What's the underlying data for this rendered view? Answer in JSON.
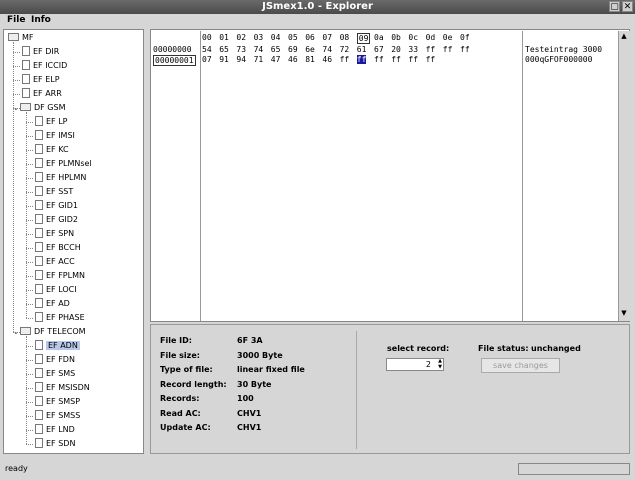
{
  "window": {
    "title": "JSmex1.0 - Explorer",
    "controls": [
      "▢",
      "✕"
    ]
  },
  "menu": [
    {
      "label": "File"
    },
    {
      "label": "Info"
    }
  ],
  "tree": [
    {
      "label": "MF",
      "kind": "folder",
      "level": 0,
      "open": true
    },
    {
      "label": "EF DIR",
      "kind": "file",
      "level": 1
    },
    {
      "label": "EF ICCID",
      "kind": "file",
      "level": 1
    },
    {
      "label": "EF ELP",
      "kind": "file",
      "level": 1
    },
    {
      "label": "EF ARR",
      "kind": "file",
      "level": 1
    },
    {
      "label": "DF GSM",
      "kind": "folder",
      "level": 1,
      "open": true
    },
    {
      "label": "EF LP",
      "kind": "file",
      "level": 2
    },
    {
      "label": "EF IMSI",
      "kind": "file",
      "level": 2
    },
    {
      "label": "EF KC",
      "kind": "file",
      "level": 2
    },
    {
      "label": "EF PLMNsel",
      "kind": "file",
      "level": 2
    },
    {
      "label": "EF HPLMN",
      "kind": "file",
      "level": 2
    },
    {
      "label": "EF SST",
      "kind": "file",
      "level": 2
    },
    {
      "label": "EF GID1",
      "kind": "file",
      "level": 2
    },
    {
      "label": "EF GID2",
      "kind": "file",
      "level": 2
    },
    {
      "label": "EF SPN",
      "kind": "file",
      "level": 2
    },
    {
      "label": "EF BCCH",
      "kind": "file",
      "level": 2
    },
    {
      "label": "EF ACC",
      "kind": "file",
      "level": 2
    },
    {
      "label": "EF FPLMN",
      "kind": "file",
      "level": 2
    },
    {
      "label": "EF LOCI",
      "kind": "file",
      "level": 2
    },
    {
      "label": "EF AD",
      "kind": "file",
      "level": 2
    },
    {
      "label": "EF PHASE",
      "kind": "file",
      "level": 2
    },
    {
      "label": "DF TELECOM",
      "kind": "folder",
      "level": 1,
      "open": true
    },
    {
      "label": "EF ADN",
      "kind": "file",
      "level": 2,
      "selected": true
    },
    {
      "label": "EF FDN",
      "kind": "file",
      "level": 2
    },
    {
      "label": "EF SMS",
      "kind": "file",
      "level": 2
    },
    {
      "label": "EF MSISDN",
      "kind": "file",
      "level": 2
    },
    {
      "label": "EF SMSP",
      "kind": "file",
      "level": 2
    },
    {
      "label": "EF SMSS",
      "kind": "file",
      "level": 2
    },
    {
      "label": "EF LND",
      "kind": "file",
      "level": 2
    },
    {
      "label": "EF SDN",
      "kind": "file",
      "level": 2
    }
  ],
  "hex": {
    "column_headers": [
      "00",
      "01",
      "02",
      "03",
      "04",
      "05",
      "06",
      "07",
      "08",
      "09",
      "0a",
      "0b",
      "0c",
      "0d",
      "0e",
      "0f"
    ],
    "highlighted_column": 9,
    "offsets": [
      "00000000",
      "00000001"
    ],
    "selected_offset": 1,
    "rows": [
      [
        "54",
        "65",
        "73",
        "74",
        "65",
        "69",
        "6e",
        "74",
        "72",
        "61",
        "67",
        "20",
        "33",
        "ff",
        "ff",
        "ff"
      ],
      [
        "07",
        "91",
        "94",
        "71",
        "47",
        "46",
        "81",
        "46",
        "ff",
        "ff",
        "ff",
        "ff",
        "ff",
        "ff"
      ]
    ],
    "cursor": {
      "row": 1,
      "col": 9
    },
    "ascii": [
      "Testeintrag 3000",
      "000qGFOF000000"
    ]
  },
  "info": {
    "fields": [
      {
        "label": "File ID:",
        "value": "6F 3A"
      },
      {
        "label": "File size:",
        "value": "3000 Byte"
      },
      {
        "label": "Type of file:",
        "value": "linear fixed file"
      },
      {
        "label": "Record length:",
        "value": "30 Byte"
      },
      {
        "label": "Records:",
        "value": "100"
      },
      {
        "label": "Read AC:",
        "value": "CHV1"
      },
      {
        "label": "Update AC:",
        "value": "CHV1"
      }
    ],
    "select_record_label": "select record:",
    "select_record_value": "2",
    "file_status_label": "File status:",
    "file_status_value": "unchanged",
    "save_button": "save changes"
  },
  "status": {
    "text": "ready"
  }
}
